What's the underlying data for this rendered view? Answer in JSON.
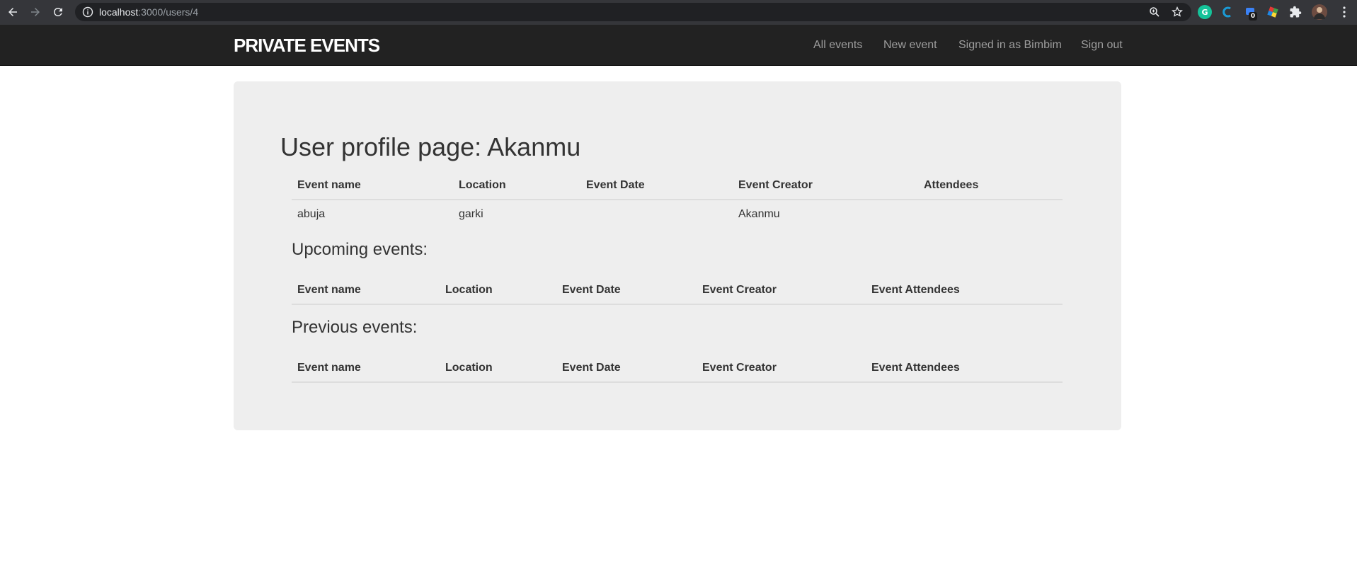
{
  "browser": {
    "url_host": "localhost",
    "url_path": ":3000/users/4",
    "extension_badge": "0",
    "icons": [
      "back-icon",
      "forward-icon",
      "reload-icon",
      "info-icon",
      "zoom-icon",
      "star-icon",
      "grammarly-icon",
      "extension-c-icon",
      "extension-tab-icon",
      "extension-color-icon",
      "puzzle-icon",
      "profile-avatar",
      "menu-dots-icon"
    ]
  },
  "navbar": {
    "brand": "PRIVATE EVENTS",
    "links": {
      "all_events": "All events",
      "new_event": "New event",
      "signed_in": "Signed in as Bimbim",
      "sign_out": "Sign out"
    }
  },
  "profile": {
    "title": "User profile page: Akanmu",
    "created_table": {
      "headers": [
        "Event name",
        "Location",
        "Event Date",
        "Event Creator",
        "Attendees"
      ],
      "rows": [
        [
          "abuja",
          "garki",
          "",
          "Akanmu",
          ""
        ]
      ]
    },
    "upcoming": {
      "title": "Upcoming events:",
      "headers": [
        "Event name",
        "Location",
        "Event Date",
        "Event Creator",
        "Event Attendees"
      ]
    },
    "previous": {
      "title": "Previous events:",
      "headers": [
        "Event name",
        "Location",
        "Event Date",
        "Event Creator",
        "Event Attendees"
      ]
    }
  }
}
